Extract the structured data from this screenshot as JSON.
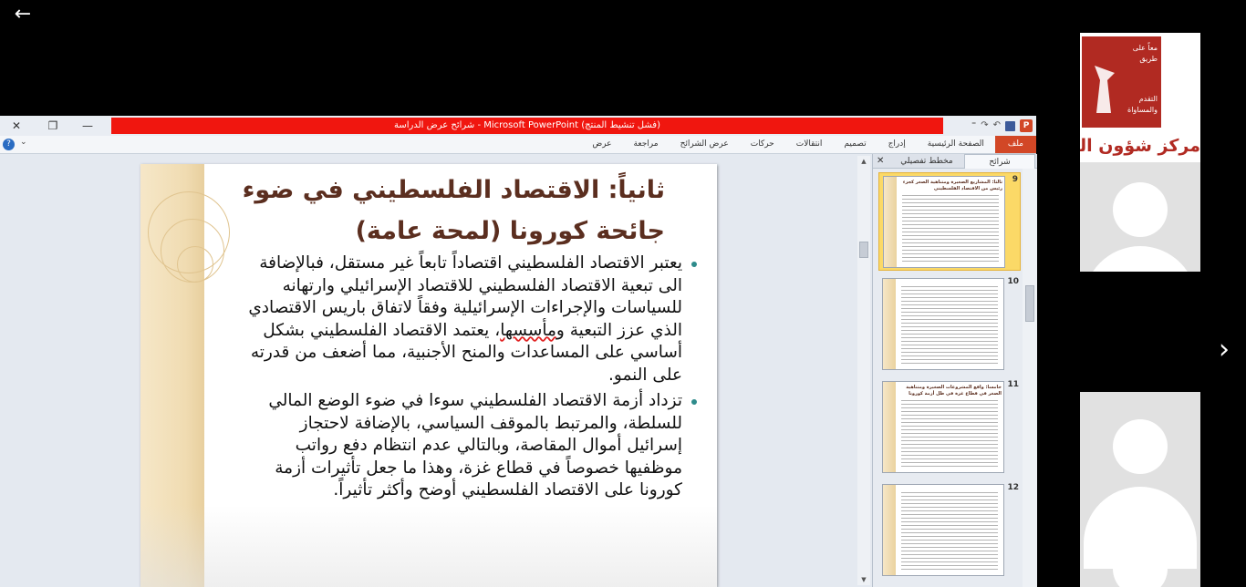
{
  "window": {
    "title": "شرائح عرض الدراسة - Microsoft PowerPoint (فشل تنشيط المنتج)",
    "controls": {
      "close": "✕",
      "restore": "❐",
      "minimize": "—"
    },
    "qat": {
      "app_icon": "P",
      "undo": "↶",
      "redo": "↷",
      "more": "⁼"
    }
  },
  "ribbon": {
    "tabs": [
      {
        "label": "ملف",
        "active": true
      },
      {
        "label": "الصفحة الرئيسية"
      },
      {
        "label": "إدراج"
      },
      {
        "label": "تصميم"
      },
      {
        "label": "انتقالات"
      },
      {
        "label": "حركات"
      },
      {
        "label": "عرض الشرائح"
      },
      {
        "label": "مراجعة"
      },
      {
        "label": "عرض"
      }
    ],
    "help": "?",
    "minimize": "⌄"
  },
  "slide": {
    "title": "ثانياً: الاقتصاد الفلسطيني في ضوء جائحة كورونا (لمحة عامة)",
    "bullets": [
      {
        "before": "يعتبر الاقتصاد الفلسطيني اقتصاداً تابعاً غير مستقل، فبالإضافة الى تبعية الاقتصاد الفلسطيني للاقتصاد الإسرائيلي وارتهانه للسياسات والإجراءات الإسرائيلية وفقاً لاتفاق باريس الاقتصادي الذي عزز التبعية و",
        "misspelled": "مأسسها",
        "after": "، يعتمد الاقتصاد الفلسطيني بشكل أساسي على المساعدات والمنح الأجنبية، مما أضعف من قدرته على النمو."
      },
      {
        "before": "تزداد أزمة الاقتصاد الفلسطيني سوءا في ضوء الوضع المالي للسلطة، والمرتبط بالموقف السياسي، بالإضافة لاحتجاز إسرائيل أموال المقاصة، وبالتالي عدم انتظام دفع رواتب موظفيها خصوصاً في قطاع غزة، وهذا ما جعل تأثيرات أزمة كورونا على الاقتصاد الفلسطيني أوضح وأكثر تأثيراً.",
        "misspelled": "",
        "after": ""
      }
    ]
  },
  "panel": {
    "tab_slides": "شرائح",
    "tab_outline": "مخطط تفصيلي",
    "close": "✕",
    "thumbnails": [
      {
        "number": "9",
        "title": "ثالثاً: المشاريع الصغيرة ومتناهية الصغر كجزء رئيس من الاقتصاد الفلسطيني",
        "selected": true
      },
      {
        "number": "10",
        "title": "",
        "selected": false
      },
      {
        "number": "11",
        "title": "خامساً: واقع المشروعات الصغيرة ومتناهية الصغر في قطاع غزة في ظل أزمة كورونا",
        "selected": false
      },
      {
        "number": "12",
        "title": "",
        "selected": false
      }
    ]
  },
  "viewer": {
    "back": "←",
    "prev": "‹",
    "next": "›"
  },
  "participants": {
    "logo_lines": [
      "معاً على",
      "طريق",
      "التقدم",
      "والمساواة"
    ],
    "logo_name": "مركز شؤون المرأة - "
  },
  "colors": {
    "title_bar_red": "#f0160f",
    "file_tab": "#d24726",
    "slide_title": "#5b2e1f",
    "bullet": "#2e8b8b",
    "logo_red": "#b12a22"
  }
}
